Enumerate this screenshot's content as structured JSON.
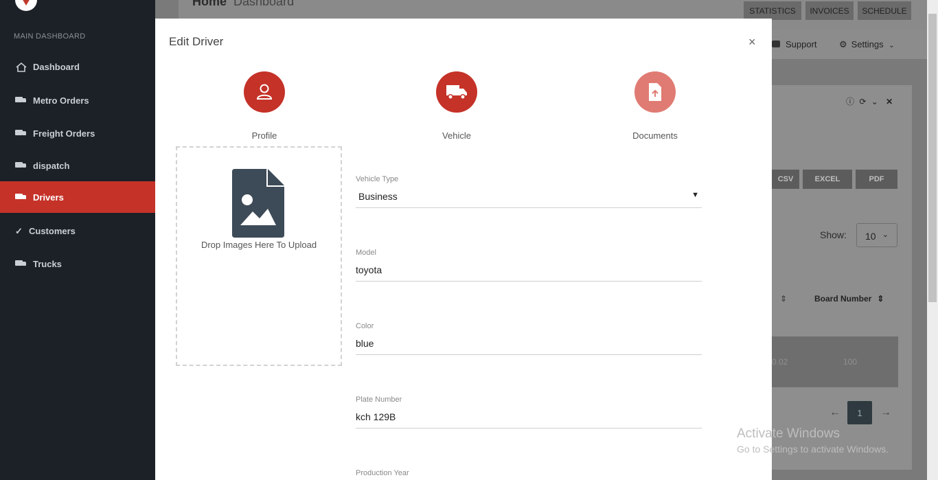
{
  "sidebar": {
    "section_label": "MAIN DASHBOARD",
    "items": [
      {
        "label": "Dashboard",
        "icon": "home-icon"
      },
      {
        "label": "Metro Orders",
        "icon": "truck-icon"
      },
      {
        "label": "Freight Orders",
        "icon": "truck-icon"
      },
      {
        "label": "dispatch",
        "icon": "truck-icon"
      },
      {
        "label": "Drivers",
        "icon": "truck-icon",
        "active": true
      },
      {
        "label": "Customers",
        "icon": "check-icon"
      },
      {
        "label": "Trucks",
        "icon": "truck-icon"
      }
    ]
  },
  "header": {
    "breadcrumb_home": "Home",
    "breadcrumb_current": "Dashboard",
    "buttons": [
      "STATISTICS",
      "INVOICES",
      "SCHEDULE"
    ],
    "support_label": "Support",
    "settings_label": "Settings"
  },
  "background_panel": {
    "export_buttons": [
      "CSV",
      "EXCEL",
      "PDF"
    ],
    "show_label": "Show:",
    "show_value": "10",
    "column_header": "Board Number",
    "cells": [
      "0.02",
      "100"
    ],
    "current_page": "1"
  },
  "modal": {
    "title": "Edit Driver",
    "close_label": "×",
    "steps": [
      {
        "label": "Profile",
        "icon": "user-icon"
      },
      {
        "label": "Vehicle",
        "icon": "truck-icon"
      },
      {
        "label": "Documents",
        "icon": "file-upload-icon"
      }
    ],
    "dropzone_label": "Drop Images Here To Upload",
    "fields": {
      "vehicle_type": {
        "label": "Vehicle Type",
        "value": "Business"
      },
      "model": {
        "label": "Model",
        "value": "toyota"
      },
      "color": {
        "label": "Color",
        "value": "blue"
      },
      "plate_number": {
        "label": "Plate Number",
        "value": "kch 129B"
      },
      "production_year": {
        "label": "Production Year",
        "value": ""
      }
    }
  },
  "watermark": {
    "line1": "Activate Windows",
    "line2": "Go to Settings to activate Windows."
  },
  "colors": {
    "accent_red": "#c53228",
    "step_inactive": "#e07b73",
    "sidebar_bg": "#1b2126"
  }
}
